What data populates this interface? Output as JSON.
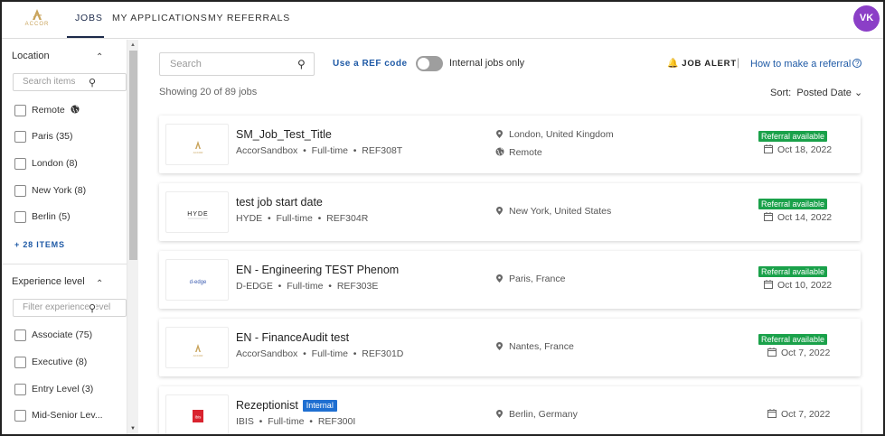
{
  "nav": {
    "logo_text": "ACCOR",
    "tabs": [
      {
        "label": "JOBS"
      },
      {
        "label": "MY APPLICATIONS"
      },
      {
        "label": "MY REFERRALS"
      }
    ],
    "avatar_initials": "VK"
  },
  "sidebar": {
    "location": {
      "title": "Location",
      "search_placeholder": "Search items",
      "items": [
        {
          "label": "Remote"
        },
        {
          "label": "Paris (35)"
        },
        {
          "label": "London (8)"
        },
        {
          "label": "New York (8)"
        },
        {
          "label": "Berlin (5)"
        }
      ],
      "more_label": "+ 28 ITEMS"
    },
    "experience": {
      "title": "Experience level",
      "search_placeholder": "Filter experience level",
      "items": [
        {
          "label": "Associate (75)"
        },
        {
          "label": "Executive (8)"
        },
        {
          "label": "Entry Level (3)"
        },
        {
          "label": "Mid-Senior Lev..."
        }
      ]
    }
  },
  "toolbar": {
    "search_placeholder": "Search",
    "ref_code_label": "Use a REF code",
    "internal_toggle_label": "Internal jobs only",
    "job_alert_label": "JOB ALERT",
    "howto_label": "How to make a referral",
    "showing_text": "Showing 20 of 89 jobs",
    "sort_label": "Sort:",
    "sort_value": "Posted Date"
  },
  "jobs": [
    {
      "title": "SM_Job_Test_Title",
      "company": "AccorSandbox",
      "type": "Full-time",
      "ref": "REF308T",
      "location": "London, United Kingdom",
      "remote": "Remote",
      "badge": "Referral available",
      "date": "Oct 18, 2022",
      "logo": "accor"
    },
    {
      "title": "test job start date",
      "company": "HYDE",
      "type": "Full-time",
      "ref": "REF304R",
      "location": "New York, United States",
      "badge": "Referral available",
      "date": "Oct 14, 2022",
      "logo": "hyde",
      "logo_text": "HYDE"
    },
    {
      "title": "EN - Engineering TEST Phenom",
      "company": "D-EDGE",
      "type": "Full-time",
      "ref": "REF303E",
      "location": "Paris, France",
      "badge": "Referral available",
      "date": "Oct 10, 2022",
      "logo": "dedge",
      "logo_text": "d-edge"
    },
    {
      "title": "EN - FinanceAudit test",
      "company": "AccorSandbox",
      "type": "Full-time",
      "ref": "REF301D",
      "location": "Nantes, France",
      "badge": "Referral available",
      "date": "Oct 7, 2022",
      "logo": "accor"
    },
    {
      "title": "Rezeptionist",
      "internal_badge": "Internal",
      "company": "IBIS",
      "type": "Full-time",
      "ref": "REF300I",
      "location": "Berlin, Germany",
      "date": "Oct 7, 2022",
      "logo": "ibis",
      "logo_text": "ibis"
    }
  ],
  "colors": {
    "accent_blue": "#1f5aa6",
    "referral_green": "#1aa14a",
    "internal_blue": "#1f6fd1",
    "avatar_purple": "#8b3fc7",
    "accor_gold": "#c9a45c"
  }
}
